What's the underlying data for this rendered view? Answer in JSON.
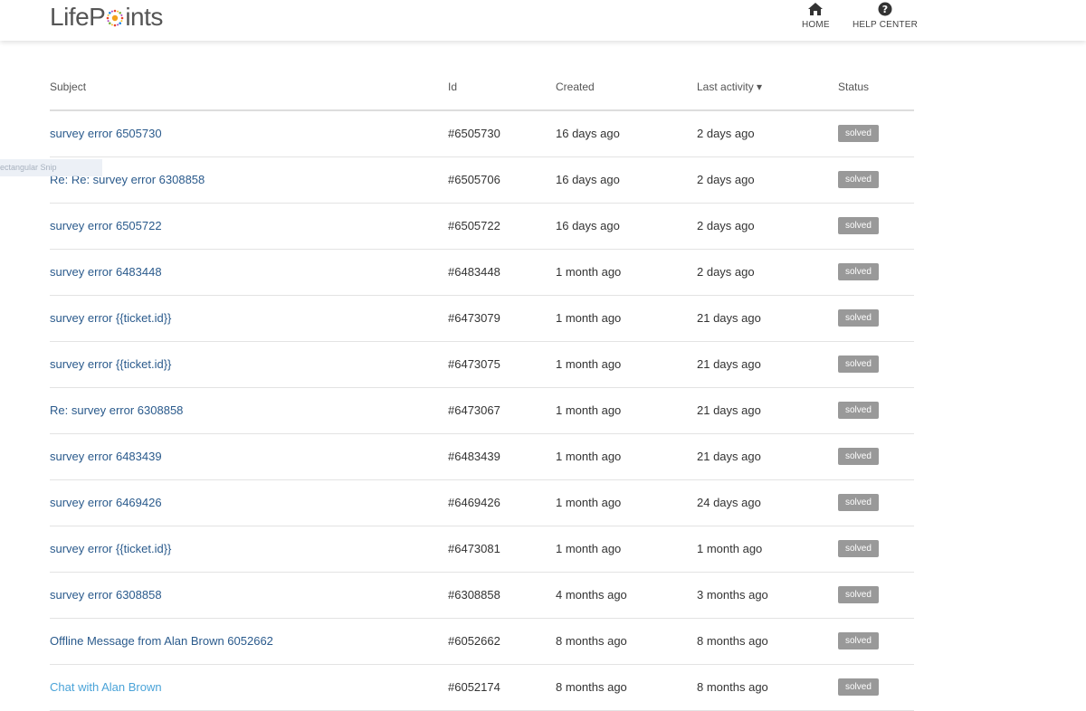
{
  "header": {
    "logo_text_before": "LifeP",
    "logo_text_after": "ints",
    "nav": [
      {
        "label": "HOME",
        "icon": "home-icon"
      },
      {
        "label": "HELP CENTER",
        "icon": "question-circle-icon"
      }
    ]
  },
  "tooltip": {
    "text": "ectangular Snip"
  },
  "table": {
    "columns": {
      "subject": "Subject",
      "id": "Id",
      "created": "Created",
      "activity": "Last activity ▾",
      "status": "Status"
    },
    "rows": [
      {
        "subject": "survey error 6505730",
        "id": "#6505730",
        "created": "16 days ago",
        "activity": "2 days ago",
        "status": "solved"
      },
      {
        "subject": "Re: Re: survey error 6308858",
        "id": "#6505706",
        "created": "16 days ago",
        "activity": "2 days ago",
        "status": "solved"
      },
      {
        "subject": "survey error 6505722",
        "id": "#6505722",
        "created": "16 days ago",
        "activity": "2 days ago",
        "status": "solved"
      },
      {
        "subject": "survey error 6483448",
        "id": "#6483448",
        "created": "1 month ago",
        "activity": "2 days ago",
        "status": "solved"
      },
      {
        "subject": "survey error {{ticket.id}}",
        "id": "#6473079",
        "created": "1 month ago",
        "activity": "21 days ago",
        "status": "solved"
      },
      {
        "subject": "survey error {{ticket.id}}",
        "id": "#6473075",
        "created": "1 month ago",
        "activity": "21 days ago",
        "status": "solved"
      },
      {
        "subject": "Re: survey error 6308858",
        "id": "#6473067",
        "created": "1 month ago",
        "activity": "21 days ago",
        "status": "solved"
      },
      {
        "subject": "survey error 6483439",
        "id": "#6483439",
        "created": "1 month ago",
        "activity": "21 days ago",
        "status": "solved"
      },
      {
        "subject": "survey error 6469426",
        "id": "#6469426",
        "created": "1 month ago",
        "activity": "24 days ago",
        "status": "solved"
      },
      {
        "subject": "survey error {{ticket.id}}",
        "id": "#6473081",
        "created": "1 month ago",
        "activity": "1 month ago",
        "status": "solved"
      },
      {
        "subject": "survey error 6308858",
        "id": "#6308858",
        "created": "4 months ago",
        "activity": "3 months ago",
        "status": "solved"
      },
      {
        "subject": "Offline Message from Alan Brown 6052662",
        "id": "#6052662",
        "created": "8 months ago",
        "activity": "8 months ago",
        "status": "solved"
      },
      {
        "subject": "Chat with Alan Brown",
        "id": "#6052174",
        "created": "8 months ago",
        "activity": "8 months ago",
        "status": "solved"
      }
    ]
  }
}
